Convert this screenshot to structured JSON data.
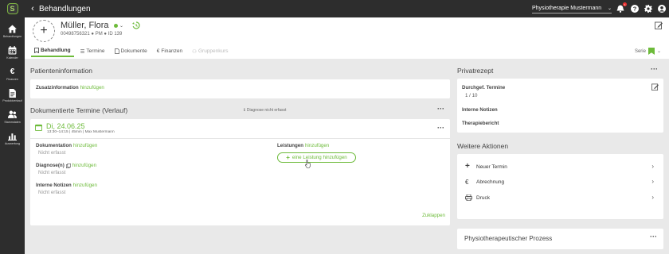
{
  "sidebar": {
    "logo": "S",
    "items": [
      {
        "label": "Behandlungen",
        "icon": "home-icon"
      },
      {
        "label": "Kalender",
        "icon": "calendar-icon"
      },
      {
        "label": "Finanzen",
        "icon": "euro-icon"
      },
      {
        "label": "Produktverkauf",
        "icon": "document-icon"
      },
      {
        "label": "Stammdaten",
        "icon": "people-icon"
      },
      {
        "label": "Auswertung",
        "icon": "chart-icon"
      }
    ]
  },
  "topbar": {
    "title": "Behandlungen",
    "practice": "Physiotherapie Mustermann",
    "notification_count": "1"
  },
  "patient": {
    "name": "Müller, Flora",
    "phone": "00498756321",
    "type": "PM",
    "id": "ID 139"
  },
  "tabs": [
    {
      "label": "Behandlung",
      "active": true
    },
    {
      "label": "Termine"
    },
    {
      "label": "Dokumente"
    },
    {
      "label": "Finanzen"
    },
    {
      "label": "Gruppenkurs",
      "disabled": true
    }
  ],
  "serie_label": "Serie",
  "patienteninfo": {
    "title": "Patienteninformation",
    "zusatz_label": "Zusatzinformation",
    "zusatz_link": "hinzufügen"
  },
  "termine": {
    "title": "Dokumentierte Termine (Verlauf)",
    "diagnose_note": "Diagnose nicht erfasst",
    "date": "Di, 24.06.25",
    "time_info": "13:30–14:15 | 45min | Max Mustermann",
    "doku_label": "Dokumentation",
    "doku_link": "hinzufügen",
    "doku_value": "Nicht erfasst",
    "diag_label": "Diagnose(n)",
    "diag_link": "hinzufügen",
    "diag_value": "Nicht erfasst",
    "notiz_label": "Interne Notizen",
    "notiz_link": "hinzufügen",
    "notiz_value": "Nicht erfasst",
    "leist_label": "Leistungen",
    "leist_link": "hinzufügen",
    "add_leistung": "eine Leistung hinzufügen",
    "collapse": "Zuklappen"
  },
  "privatrezept": {
    "title": "Privatrezept",
    "durchgef_label": "Durchgef. Termine",
    "durchgef_value": "1 / 10",
    "notizen_label": "Interne Notizen",
    "bericht_label": "Therapiebericht"
  },
  "aktionen": {
    "title": "Weitere Aktionen",
    "items": [
      {
        "label": "Neuer Termin",
        "icon": "plus-icon"
      },
      {
        "label": "Abrechnung",
        "icon": "euro-icon"
      },
      {
        "label": "Druck",
        "icon": "printer-icon"
      }
    ]
  },
  "prozess": {
    "title": "Physiotherapeutischer Prozess"
  },
  "colors": {
    "accent": "#6dbb3a",
    "sidebar": "#2d2d2d",
    "background": "#e9e9e9"
  }
}
